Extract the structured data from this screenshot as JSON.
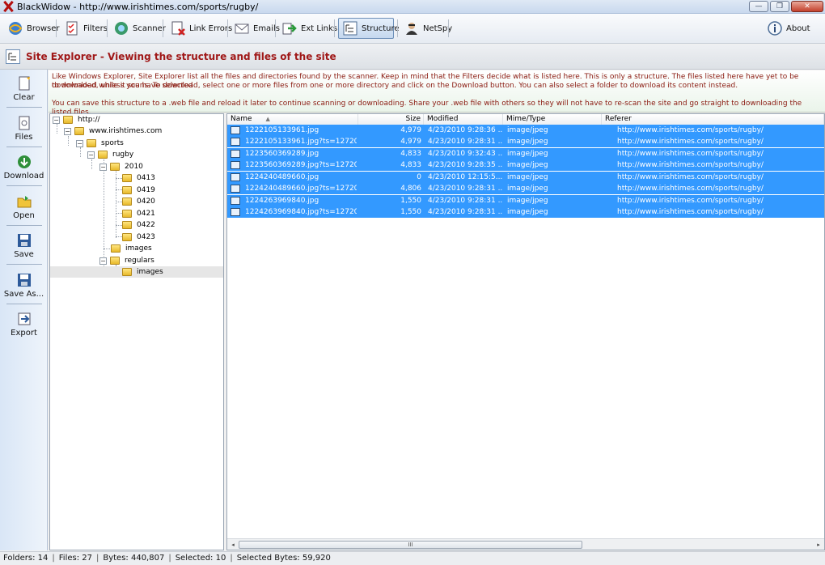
{
  "window": {
    "title": "BlackWidow - http://www.irishtimes.com/sports/rugby/",
    "controls": {
      "minimize": "—",
      "maximize": "❐",
      "close": "✕"
    }
  },
  "toolbar": {
    "items": [
      {
        "label": "Browser",
        "icon": "browser-globe-icon"
      },
      {
        "label": "Filters",
        "icon": "filters-checklist-icon"
      },
      {
        "label": "Scanner",
        "icon": "scanner-icon"
      },
      {
        "label": "Link Errors",
        "icon": "link-errors-icon"
      },
      {
        "label": "Emails",
        "icon": "email-envelope-icon"
      },
      {
        "label": "Ext Links",
        "icon": "external-links-icon"
      },
      {
        "label": "Structure",
        "icon": "structure-icon",
        "active": true
      },
      {
        "label": "NetSpy",
        "icon": "netspy-agent-icon"
      }
    ],
    "about_label": "About"
  },
  "header": {
    "title": "Site Explorer - Viewing the structure and files of the site"
  },
  "sidebar": {
    "items": [
      {
        "label": "Clear",
        "icon": "clear-page-icon"
      },
      {
        "label": "Files",
        "icon": "files-icon"
      },
      {
        "label": "Download",
        "icon": "download-icon"
      },
      {
        "label": "Open",
        "icon": "open-folder-icon"
      },
      {
        "label": "Save",
        "icon": "save-disk-icon"
      },
      {
        "label": "Save As...",
        "icon": "save-as-disk-icon"
      },
      {
        "label": "Export",
        "icon": "export-icon"
      }
    ]
  },
  "info": {
    "line1": "Like Windows Explorer, Site Explorer list all the files and directories found by the scanner. Keep in mind that the Filters decide what is listed here. This is only a structure. The files listed here have yet to be downloaded, unless you have selected",
    "line2": "to download while it scans. To download, select one or more files from one or more directory and click on the Download button. You can also select a folder to download its content instead.",
    "line3": "You can save this structure to a .web file and reload it later to continue scanning or downloading. Share your .web file with others so they will not have to re-scan the site and go straight to downloading the listed files."
  },
  "tree": {
    "nodes": [
      {
        "label": "http://",
        "expander": "−"
      },
      {
        "label": "www.irishtimes.com",
        "expander": "−"
      },
      {
        "label": "sports",
        "expander": "−"
      },
      {
        "label": "rugby",
        "expander": "−"
      },
      {
        "label": "2010",
        "expander": "−"
      },
      {
        "label": "0413"
      },
      {
        "label": "0419"
      },
      {
        "label": "0420"
      },
      {
        "label": "0421"
      },
      {
        "label": "0422"
      },
      {
        "label": "0423"
      },
      {
        "label": "images"
      },
      {
        "label": "regulars",
        "expander": "−"
      },
      {
        "label": "images",
        "selected": true
      }
    ]
  },
  "list": {
    "columns": {
      "name": "Name",
      "size": "Size",
      "modified": "Modified",
      "mime": "Mime/Type",
      "referer": "Referer"
    },
    "sort_indicator": "▲",
    "rows": [
      {
        "name": "1222105133961.jpg",
        "size": "4,979",
        "modified": "4/23/2010 9:28:36 ...",
        "mime": "image/jpeg",
        "referer": "http://www.irishtimes.com/sports/rugby/"
      },
      {
        "name": "1222105133961.jpg?ts=127201...",
        "size": "4,979",
        "modified": "4/23/2010 9:28:31 ...",
        "mime": "image/jpeg",
        "referer": "http://www.irishtimes.com/sports/rugby/"
      },
      {
        "name": "1223560369289.jpg",
        "size": "4,833",
        "modified": "4/23/2010 9:32:43 ...",
        "mime": "image/jpeg",
        "referer": "http://www.irishtimes.com/sports/rugby/"
      },
      {
        "name": "1223560369289.jpg?ts=127201...",
        "size": "4,833",
        "modified": "4/23/2010 9:28:35 ...",
        "mime": "image/jpeg",
        "referer": "http://www.irishtimes.com/sports/rugby/"
      },
      {
        "name": "1224240489660.jpg",
        "size": "0",
        "modified": "4/23/2010 12:15:5...",
        "mime": "image/jpeg",
        "referer": "http://www.irishtimes.com/sports/rugby/"
      },
      {
        "name": "1224240489660.jpg?ts=127201...",
        "size": "4,806",
        "modified": "4/23/2010 9:28:31 ...",
        "mime": "image/jpeg",
        "referer": "http://www.irishtimes.com/sports/rugby/"
      },
      {
        "name": "1224263969840.jpg",
        "size": "1,550",
        "modified": "4/23/2010 9:28:31 ...",
        "mime": "image/jpeg",
        "referer": "http://www.irishtimes.com/sports/rugby/"
      },
      {
        "name": "1224263969840.jpg?ts=127201...",
        "size": "1,550",
        "modified": "4/23/2010 9:28:31 ...",
        "mime": "image/jpeg",
        "referer": "http://www.irishtimes.com/sports/rugby/"
      }
    ],
    "scroll_grip": "III",
    "scroll_left": "◂",
    "scroll_right": "▸"
  },
  "status": {
    "folders": "Folders: 14",
    "files": "Files: 27",
    "bytes": "Bytes: 440,807",
    "selected": "Selected: 10",
    "selected_bytes": "Selected Bytes: 59,920"
  },
  "colors": {
    "selection": "#3399ff",
    "header_title": "#a01818",
    "info_text": "#8a1a10"
  }
}
